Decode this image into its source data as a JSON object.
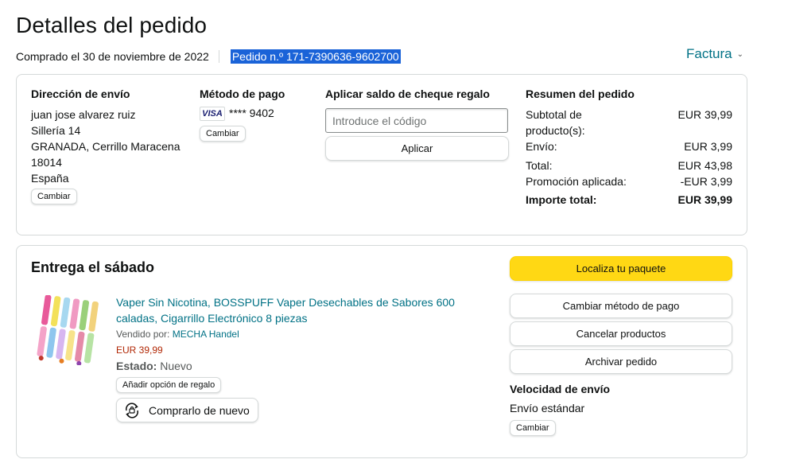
{
  "page": {
    "title": "Detalles del pedido",
    "purchase_date": "Comprado el 30 de noviembre de 2022",
    "order_number": "Pedido n.º 171-7390636-9602700",
    "invoice_label": "Factura"
  },
  "shipping": {
    "heading": "Dirección de envío",
    "lines": [
      "juan jose alvarez ruiz",
      "Sillería 14",
      "GRANADA, Cerrillo Maracena",
      "18014",
      "España"
    ],
    "change_label": "Cambiar"
  },
  "payment": {
    "heading": "Método de pago",
    "card_brand": "VISA",
    "card_digits": "**** 9402",
    "change_label": "Cambiar"
  },
  "gift_card": {
    "heading": "Aplicar saldo de cheque regalo",
    "placeholder": "Introduce el código",
    "apply_label": "Aplicar"
  },
  "summary": {
    "heading": "Resumen del pedido",
    "rows": [
      {
        "label": "Subtotal de producto(s):",
        "value": "EUR 39,99"
      },
      {
        "label": "Envío:",
        "value": "EUR 3,99"
      },
      {
        "label": "Total:",
        "value": "EUR 43,98"
      },
      {
        "label": "Promoción aplicada:",
        "value": "-EUR 3,99"
      }
    ],
    "total_label": "Importe total:",
    "total_value": "EUR 39,99"
  },
  "delivery": {
    "title": "Entrega el sábado",
    "product_title": "Vaper Sin Nicotina, BOSSPUFF Vaper Desechables de Sabores 600 caladas, Cigarrillo Electrónico 8 piezas",
    "sold_by_label": "Vendido por:",
    "seller": "MECHA Handel",
    "price": "EUR 39,99",
    "status_label": "Estado:",
    "status_value": "Nuevo",
    "gift_option_label": "Añadir opción de regalo",
    "rebuy_label": "Comprarlo de nuevo"
  },
  "actions": {
    "track": "Localiza tu paquete",
    "change_payment": "Cambiar método de pago",
    "cancel": "Cancelar productos",
    "archive": "Archivar pedido"
  },
  "shipping_speed": {
    "heading": "Velocidad de envío",
    "value": "Envío estándar",
    "change_label": "Cambiar"
  },
  "colors": {
    "link": "#007185",
    "price": "#b12704",
    "track_button": "#ffd814",
    "selection": "#1a63d8"
  }
}
